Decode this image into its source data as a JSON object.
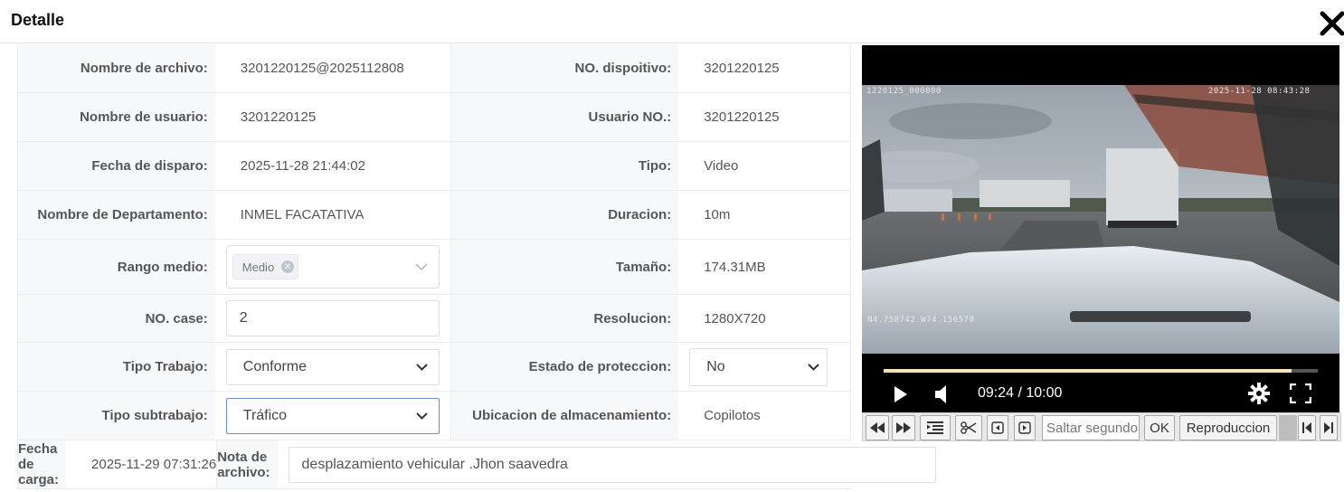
{
  "dialog": {
    "title": "Detalle"
  },
  "rows": [
    {
      "label": "Nombre de archivo:",
      "value": "3201220125@2025112808",
      "label2": "NO. dispoitivo:",
      "value2": "3201220125"
    },
    {
      "label": "Nombre de usuario:",
      "value": "3201220125",
      "label2": "Usuario NO.:",
      "value2": "3201220125"
    },
    {
      "label": "Fecha de disparo:",
      "value": "2025-11-28 21:44:02",
      "label2": "Tipo:",
      "value2": "Video"
    },
    {
      "label": "Nombre de Departamento:",
      "value": "INMEL FACATATIVA",
      "label2": "Duracion:",
      "value2": "10m"
    },
    {
      "label": "Rango medio:",
      "tag": "Medio",
      "label2": "Tamaño:",
      "value2": "174.31MB"
    },
    {
      "label": "NO. case:",
      "input": "2",
      "label2": "Resolucion:",
      "value2": "1280X720"
    },
    {
      "label": "Tipo Trabajo:",
      "select": "Conforme",
      "label2": "Estado de proteccion:",
      "select2": "No"
    },
    {
      "label": "Tipo subtrabajo:",
      "select": "Tráfico",
      "label2": "Ubicacion de almacenamiento:",
      "value2": "Copilotos"
    },
    {
      "label": "Fecha de carga:",
      "value": "2025-11-29 07:31:26",
      "label2": "Nota de archivo:",
      "note": "desplazamiento vehicular .Jhon saavedra"
    }
  ],
  "player": {
    "osd_left": "1220125_000000",
    "osd_right": "2025-11-28 08:43:28",
    "osd_gps": "N4.758742 W74.156570",
    "time": "09:24 / 10:00",
    "progress": 0.94
  },
  "toolbar": {
    "seek_placeholder": "Saltar segundo",
    "ok_label": "OK",
    "playback_label": "Reproduccion"
  },
  "icons": [
    "close-icon",
    "play-icon",
    "volume-icon",
    "gear-icon",
    "fullscreen-icon",
    "rewind-icon",
    "fast-forward-icon",
    "list-icon",
    "scissors-icon",
    "frame-back-icon",
    "frame-forward-icon",
    "skip-start-icon",
    "skip-end-icon",
    "chevron-down-icon"
  ]
}
